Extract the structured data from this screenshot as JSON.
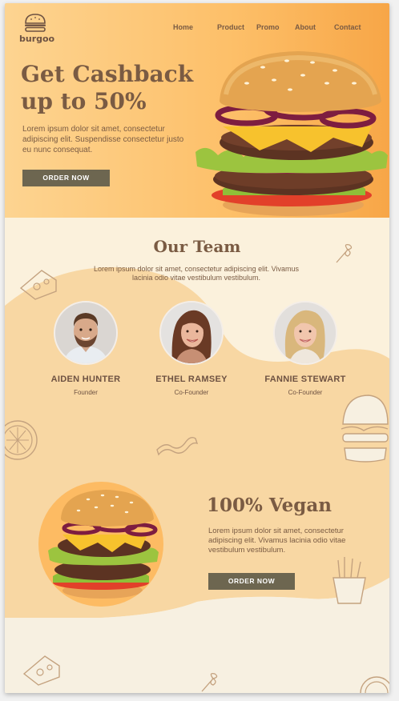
{
  "brand": {
    "name": "burgoo"
  },
  "nav": {
    "items": [
      {
        "label": "Home"
      },
      {
        "label": "Product"
      },
      {
        "label": "Promo"
      },
      {
        "label": "About"
      },
      {
        "label": "Contact"
      }
    ]
  },
  "hero": {
    "title_line1": "Get Cashback",
    "title_line2": "up to 50%",
    "text": "Lorem ipsum dolor sit amet, consectetur adipiscing elit. Suspendisse consectetur justo eu nunc consequat.",
    "button_label": "ORDER NOW"
  },
  "team": {
    "title": "Our Team",
    "text": "Lorem ipsum dolor sit amet, consectetur adipiscing elit. Vivamus lacinia odio vitae vestibulum vestibulum.",
    "members": [
      {
        "name": "AIDEN HUNTER",
        "role": "Founder"
      },
      {
        "name": "ETHEL RAMSEY",
        "role": "Co-Founder"
      },
      {
        "name": "FANNIE STEWART",
        "role": "Co-Founder"
      }
    ]
  },
  "vegan": {
    "title": "100% Vegan",
    "text": "Lorem ipsum dolor sit amet, consectetur adipiscing elit. Vivamus lacinia odio vitae vestibulum vestibulum.",
    "button_label": "ORDER NOW"
  },
  "colors": {
    "brown": "#7a5b43",
    "button": "#6d6650",
    "hero_orange": "#fdbf68",
    "cream": "#fbf1dc",
    "peach": "#f8d7a3"
  }
}
